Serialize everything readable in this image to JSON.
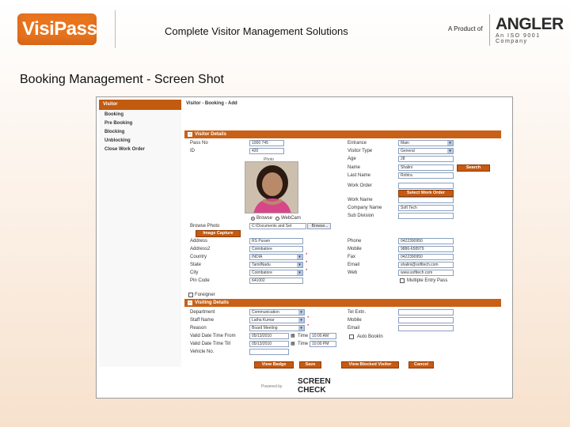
{
  "header": {
    "logo": "VisiPass",
    "tagline": "Complete Visitor Management Solutions",
    "product_of": "A Product of",
    "brand_name": "ANGLER",
    "brand_sub": "An ISO 9001 Company"
  },
  "section_title": "Booking Management - Screen Shot",
  "nav": {
    "title": "Visitor",
    "items": [
      "Booking",
      "Pre Booking",
      "Blocking",
      "Unblocking",
      "Close Work Order"
    ]
  },
  "breadcrumb": "Visitor - Booking - Add",
  "visitor_details": {
    "title": "Visitor Details",
    "pass_no_label": "Pass No",
    "pass_no": "1000 745",
    "id_label": "ID",
    "id": "420",
    "photo_caption": "Photo",
    "browse_label": "Browse",
    "webcam_label": "WebCam",
    "browse_photo_label": "Browse Photo",
    "browse_path": "C:\\Documents and Set",
    "browse_btn": "Browse...",
    "image_capture_btn": "Image Capture",
    "entrance_label": "Entrance",
    "entrance": "Main",
    "visitor_type_label": "Visitor Type",
    "visitor_type": "General",
    "age_label": "Age",
    "age": "28",
    "name_label": "Name",
    "name": "Shalini",
    "last_name_label": "Last Name",
    "last_name": "Rohira",
    "search_btn": "Search",
    "work_order_label": "Work Order",
    "select_work_order_btn": "Select Work Order",
    "work_name_label": "Work Name",
    "company_name_label": "Company Name",
    "company_name": "Soft Tech",
    "sub_division_label": "Sub Division",
    "address_label": "Address",
    "address": "RS Puram",
    "address2_label": "Address2",
    "address2": "Coimbatore",
    "country_label": "Country",
    "country": "INDIA",
    "state_label": "State",
    "state": "TamilNadu",
    "city_label": "City",
    "city": "Coimbatore",
    "pincode_label": "Pin Code",
    "pincode": "641002",
    "phone_label": "Phone",
    "phone": "0422390950",
    "mobile_label": "Mobile",
    "mobile": "9886-658979",
    "fax_label": "Fax",
    "fax": "0422390950",
    "email_label": "Email",
    "email": "shalini@softtech.com",
    "web_label": "Web",
    "web": "www.softtech.com",
    "multiple_entry_label": "Multiple Entry Pass",
    "foreigner_label": "Foreigner"
  },
  "visiting_details": {
    "title": "Visiting Details",
    "department_label": "Department",
    "department": "Communication",
    "staff_name_label": "Staff Name",
    "staff_name": "Latha Kumar",
    "reason_label": "Reason",
    "reason": "Board Meeting",
    "valid_from_label": "Valid Date Time From",
    "valid_from_date": "05/13/2010",
    "valid_from_time": "10:00 AM",
    "valid_till_label": "Valid Date Time Till",
    "valid_till_date": "05/13/2010",
    "valid_till_time": "10:00 PM",
    "time_label": "Time",
    "vehicle_label": "Vehicle No.",
    "tel_ext_label": "Tel Extn.",
    "mobile_label": "Mobile",
    "email_label": "Email",
    "auto_bookin_label": "Auto BookIn"
  },
  "actions": [
    "View Badge",
    "Save",
    "View Blocked Visitor",
    "Cancel"
  ],
  "powered_by": "Powered by",
  "footer_logo": [
    "SCREEN",
    "CHECK"
  ]
}
